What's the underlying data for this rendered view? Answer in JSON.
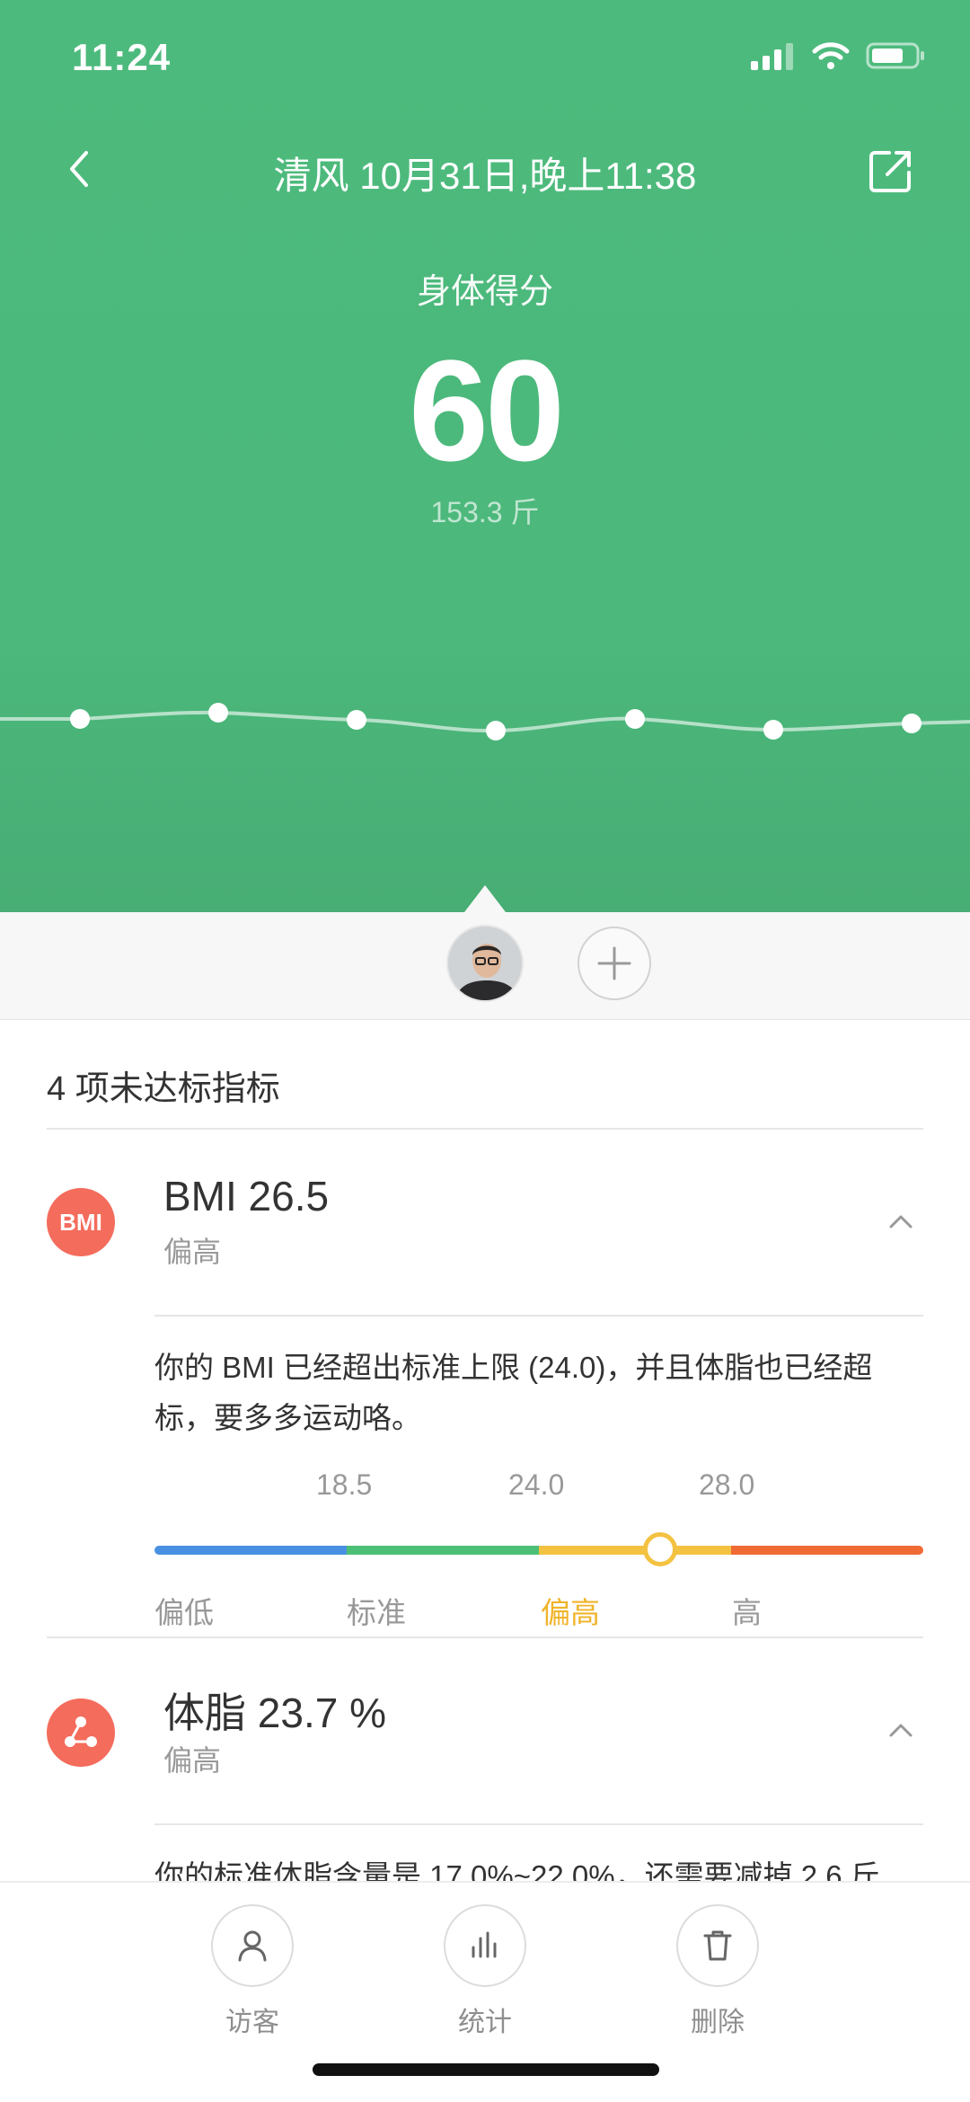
{
  "status_bar": {
    "time": "11:24"
  },
  "header": {
    "title": "清风 10月31日,晚上11:38",
    "score_label": "身体得分",
    "score": "60",
    "weight": "153.3 斤"
  },
  "section": {
    "title": "4 项未达标指标"
  },
  "metrics": [
    {
      "icon_text": "BMI",
      "title": "BMI 26.5",
      "status": "偏高",
      "description": "你的 BMI 已经超出标准上限 (24.0)，并且体脂也已经超标，要多多运动咯。",
      "scale": {
        "value": 26.5,
        "ticks": [
          "18.5",
          "24.0",
          "28.0"
        ],
        "categories": [
          "偏低",
          "标准",
          "偏高",
          "高"
        ],
        "active_category": "偏高",
        "colors": [
          "#4a90e2",
          "#4cbf77",
          "#f3c241",
          "#f06a35"
        ]
      }
    },
    {
      "icon_text": "",
      "title": "体脂 23.7 %",
      "status": "偏高",
      "description": "你的标准体脂含量是 17.0%~22.0%，还需要减掉 2.6 斤"
    }
  ],
  "toolbar": {
    "visitor": "访客",
    "stats": "统计",
    "delete": "删除"
  },
  "colors": {
    "header_green": "#4dba7d",
    "metric_icon": "#f46c5c",
    "active_range": "#f0b429"
  }
}
